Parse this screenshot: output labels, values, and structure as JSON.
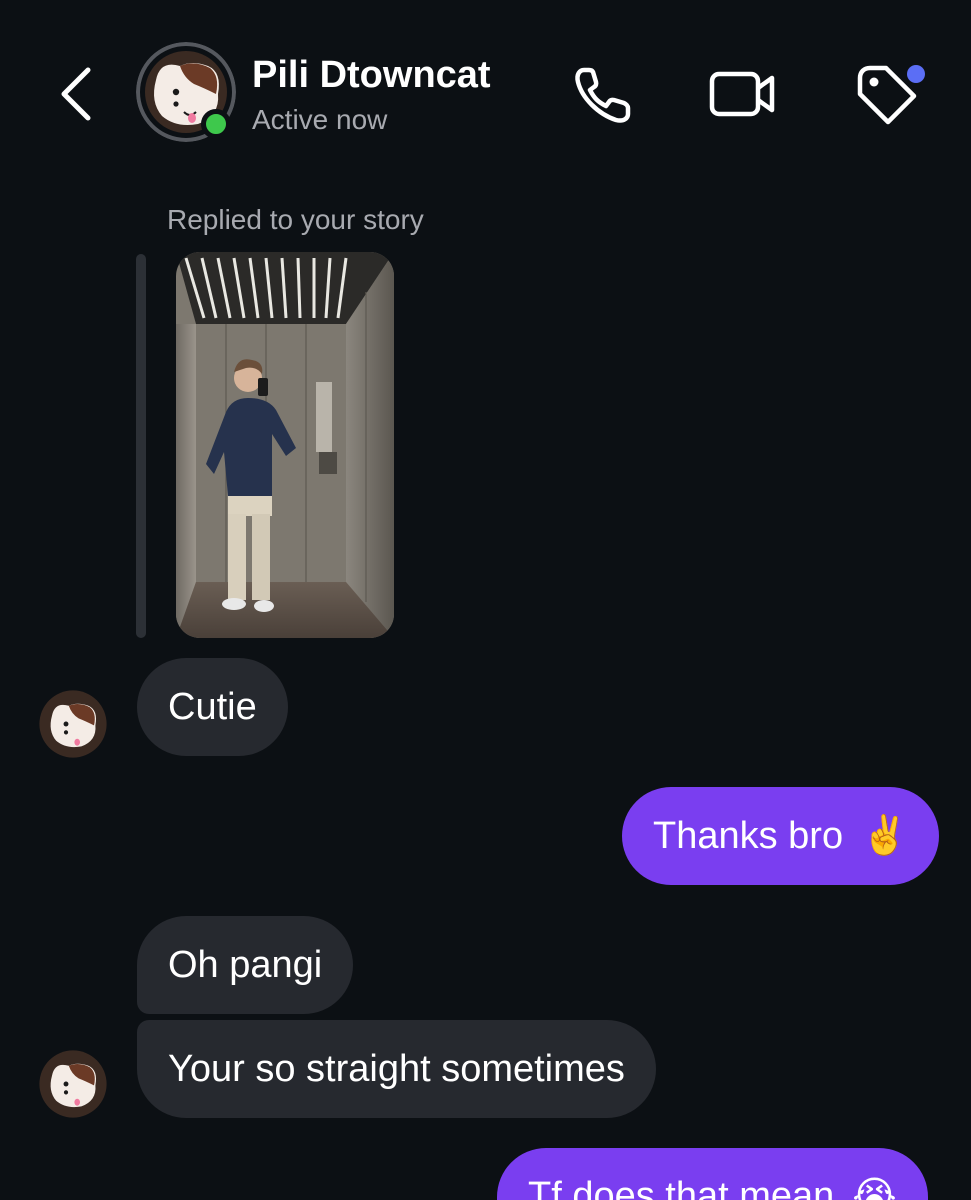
{
  "header": {
    "contact_name": "Pili Dtowncat",
    "status": "Active now",
    "icons": [
      "back-icon",
      "phone-icon",
      "video-camera-icon",
      "tag-icon"
    ],
    "notification_dot_color": "#5b6ef5",
    "online_dot_color": "#3ec84c"
  },
  "story_reply": {
    "label": "Replied to your story"
  },
  "messages": [
    {
      "from": "them",
      "text": "Cutie"
    },
    {
      "from": "me",
      "text": "Thanks bro",
      "emoji": "✌️"
    },
    {
      "from": "them",
      "text": "Oh pangi"
    },
    {
      "from": "them",
      "text": "Your so straight sometimes"
    },
    {
      "from": "me",
      "text": "Tf does that mean",
      "emoji": "😭"
    }
  ],
  "colors": {
    "background": "#0c1014",
    "incoming_bubble": "#26292f",
    "outgoing_bubble": "#7a3ef0",
    "secondary_text": "#a8aab0"
  }
}
